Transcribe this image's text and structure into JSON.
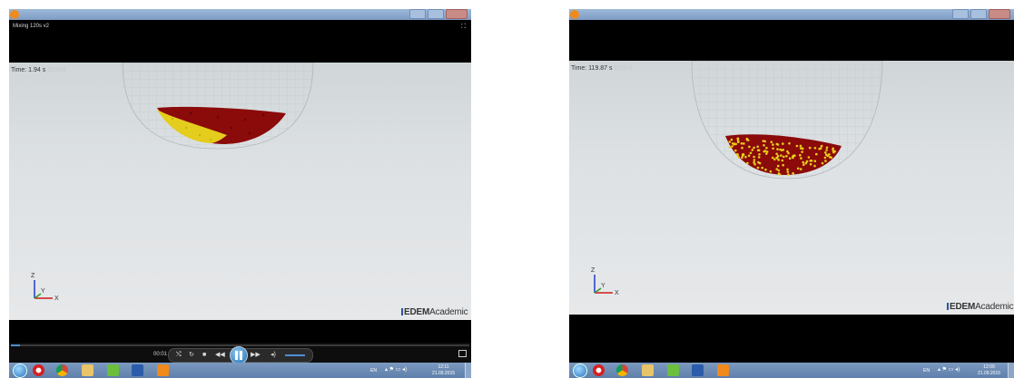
{
  "left_window": {
    "player_title": "Mixing 120s v2",
    "sim_time_label": "Time: 1.94 s",
    "sim_time_ghost": "EDEM",
    "current_time": "00:01",
    "seek_progress": 0.02,
    "volume_level": 0.55,
    "clock_time": "12:11",
    "clock_date": "21.09.2015",
    "lang": "EN"
  },
  "right_window": {
    "sim_time_label": "Time: 119.87 s",
    "sim_time_ghost": "EDEM",
    "clock_time": "12:09",
    "clock_date": "21.09.2015",
    "lang": "EN"
  },
  "logo": {
    "brand": "EDEM",
    "suffix": "Academic"
  },
  "triad_labels": {
    "z": "Z",
    "y": "Y",
    "x": "X"
  },
  "icons": {
    "fullscreen": "fullscreen-icon",
    "play_pause": "pause-icon",
    "taskbar_apps": [
      "windows-start-icon",
      "opera-icon",
      "chrome-icon",
      "file-explorer-icon",
      "utorrent-icon",
      "word-icon",
      "media-player-icon"
    ]
  },
  "colors": {
    "particle_red": "#8b0a0a",
    "particle_yellow": "#e8d21a",
    "seek_blue": "#4d8fd4"
  }
}
